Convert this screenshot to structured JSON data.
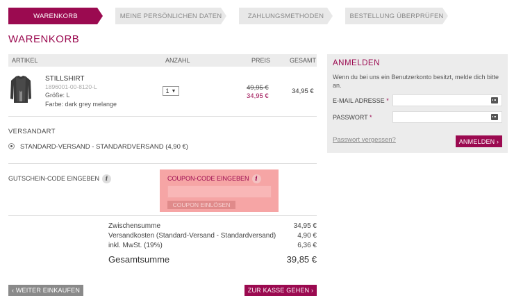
{
  "steps": [
    {
      "label": "WARENKORB",
      "active": true
    },
    {
      "label": "MEINE PERSÖNLICHEN DATEN",
      "active": false
    },
    {
      "label": "ZAHLUNGSMETHODEN",
      "active": false
    },
    {
      "label": "BESTELLUNG ÜBERPRÜFEN",
      "active": false
    }
  ],
  "page_title": "WARENKORB",
  "cart": {
    "headers": {
      "article": "ARTIKEL",
      "qty": "ANZAHL",
      "price": "PREIS",
      "total": "GESAMT"
    },
    "item": {
      "name": "STILLSHIRT",
      "sku": "1896001-00-8120-L",
      "size": "Größe:  L",
      "color": "Farbe:  dark grey melange",
      "qty": "1",
      "price_old": "49,95 €",
      "price_new": "34,95 €",
      "total": "34,95 €",
      "image_icon": "shirt-icon"
    }
  },
  "shipping": {
    "title": "VERSANDART",
    "option": "STANDARD-VERSAND - STANDARDVERSAND (4,90 €)"
  },
  "voucher": {
    "label": "GUTSCHEIN-CODE EINGEBEN",
    "coupon_title": "COUPON-CODE EINGEBEN",
    "coupon_button": "COUPON EINLÖSEN",
    "info_glyph": "i"
  },
  "totals": {
    "subtotal_label": "Zwischensumme",
    "subtotal": "34,95 €",
    "shipping_label": "Versandkosten (Standard-Versand - Standardversand)",
    "shipping": "4,90 €",
    "vat_label": "inkl. MwSt. (19%)",
    "vat": "6,36 €",
    "grand_label": "Gesamtsumme",
    "grand": "39,85 €"
  },
  "buttons": {
    "back": "‹ WEITER EINKAUFEN",
    "checkout": "ZUR KASSE GEHEN ›"
  },
  "login": {
    "title": "ANMELDEN",
    "intro": "Wenn du bei uns ein Benutzerkonto besitzt, melde dich bitte an.",
    "email_label": "E-MAIL ADRESSE",
    "password_label": "PASSWORT",
    "required_mark": "*",
    "forgot": "Passwort vergessen?",
    "submit": "ANMELDEN ›"
  },
  "colors": {
    "accent": "#9b0a50",
    "coupon_highlight": "#f6a5a5",
    "panel": "#ececec"
  }
}
